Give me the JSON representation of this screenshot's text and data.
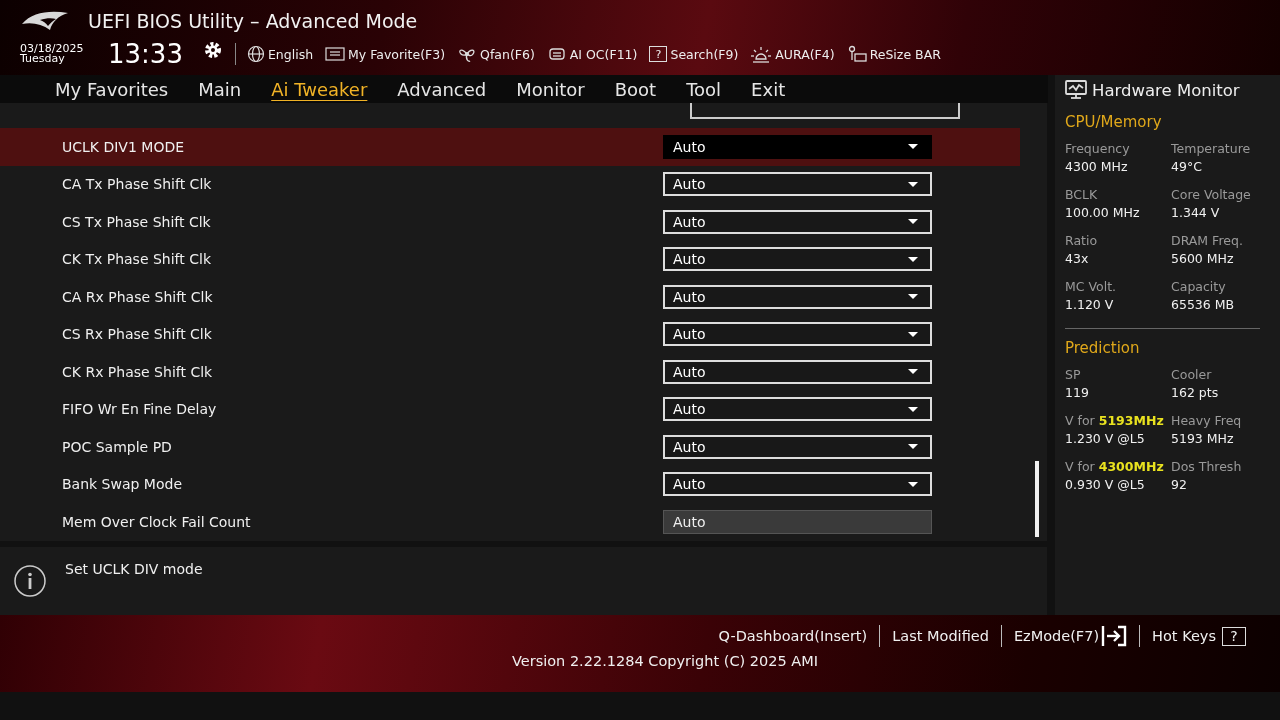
{
  "window": {
    "title": "UEFI BIOS Utility – Advanced Mode"
  },
  "header": {
    "date": "03/18/2025",
    "weekday": "Tuesday",
    "time": "13:33",
    "tools": [
      {
        "kind": "globe",
        "label": "English"
      },
      {
        "kind": "favorite",
        "label": "My Favorite(F3)"
      },
      {
        "kind": "fan",
        "label": "Qfan(F6)"
      },
      {
        "kind": "chip",
        "label": "AI OC(F11)"
      },
      {
        "kind": "search",
        "label": "Search(F9)",
        "glyph": "?"
      },
      {
        "kind": "aura",
        "label": "AURA(F4)"
      },
      {
        "kind": "bar",
        "label": "ReSize BAR"
      }
    ]
  },
  "tabs": [
    {
      "label": "My Favorites",
      "selected": false
    },
    {
      "label": "Main",
      "selected": false
    },
    {
      "label": "Ai Tweaker",
      "selected": true
    },
    {
      "label": "Advanced",
      "selected": false
    },
    {
      "label": "Monitor",
      "selected": false
    },
    {
      "label": "Boot",
      "selected": false
    },
    {
      "label": "Tool",
      "selected": false
    },
    {
      "label": "Exit",
      "selected": false
    }
  ],
  "settings": [
    {
      "label": "UCLK DIV1 MODE",
      "value": "Auto",
      "kind": "dropdown",
      "selected": true
    },
    {
      "label": "CA Tx Phase Shift Clk",
      "value": "Auto",
      "kind": "dropdown",
      "selected": false
    },
    {
      "label": "CS Tx Phase Shift Clk",
      "value": "Auto",
      "kind": "dropdown",
      "selected": false
    },
    {
      "label": "CK Tx Phase Shift Clk",
      "value": "Auto",
      "kind": "dropdown",
      "selected": false
    },
    {
      "label": "CA Rx Phase Shift Clk",
      "value": "Auto",
      "kind": "dropdown",
      "selected": false
    },
    {
      "label": "CS Rx Phase Shift Clk",
      "value": "Auto",
      "kind": "dropdown",
      "selected": false
    },
    {
      "label": "CK Rx Phase Shift Clk",
      "value": "Auto",
      "kind": "dropdown",
      "selected": false
    },
    {
      "label": "FIFO Wr En Fine Delay",
      "value": "Auto",
      "kind": "dropdown",
      "selected": false
    },
    {
      "label": "POC Sample PD",
      "value": "Auto",
      "kind": "dropdown",
      "selected": false
    },
    {
      "label": "Bank Swap Mode",
      "value": "Auto",
      "kind": "dropdown",
      "selected": false
    },
    {
      "label": "Mem Over Clock Fail Count",
      "value": "Auto",
      "kind": "readonly",
      "selected": false
    }
  ],
  "help": {
    "text": "Set UCLK DIV mode"
  },
  "hardware_monitor": {
    "title": "Hardware Monitor",
    "sections": [
      {
        "title": "CPU/Memory",
        "items": [
          {
            "label": "Frequency",
            "value": "4300 MHz"
          },
          {
            "label": "Temperature",
            "value": "49°C"
          },
          {
            "label": "BCLK",
            "value": "100.00 MHz"
          },
          {
            "label": "Core Voltage",
            "value": "1.344 V"
          },
          {
            "label": "Ratio",
            "value": "43x"
          },
          {
            "label": "DRAM Freq.",
            "value": "5600 MHz"
          },
          {
            "label": "MC Volt.",
            "value": "1.120 V"
          },
          {
            "label": "Capacity",
            "value": "65536 MB"
          }
        ]
      },
      {
        "title": "Prediction",
        "items": [
          {
            "label": "SP",
            "value": "119"
          },
          {
            "label": "Cooler",
            "value": "162 pts"
          },
          {
            "label": "V for ",
            "highlight": "5193MHz",
            "value": "1.230 V @L5"
          },
          {
            "label": "Heavy Freq",
            "value": "5193 MHz"
          },
          {
            "label": "V for ",
            "highlight": "4300MHz",
            "value": "0.930 V @L5"
          },
          {
            "label": "Dos Thresh",
            "value": "92"
          }
        ]
      }
    ]
  },
  "footer": {
    "actions": [
      {
        "kind": "plain",
        "label": "Q-Dashboard(Insert)"
      },
      {
        "kind": "plain",
        "label": "Last Modified"
      },
      {
        "kind": "exit",
        "label": "EzMode(F7)"
      },
      {
        "kind": "help",
        "label": "Hot Keys",
        "glyph": "?"
      }
    ],
    "version": "Version 2.22.1284 Copyright (C) 2025 AMI"
  }
}
